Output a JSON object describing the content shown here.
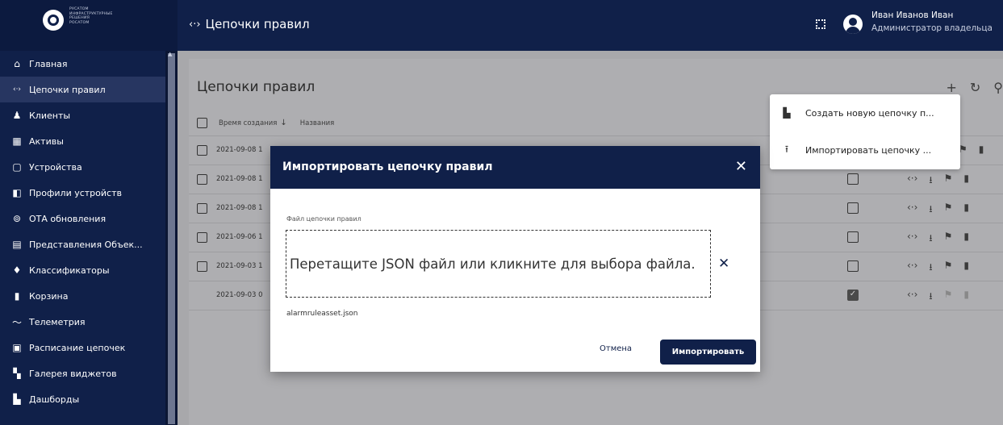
{
  "logo": {
    "lines": [
      "РУСАТОМ",
      "ИНФРАСТРУКТУРНЫЕ",
      "РЕШЕНИЯ",
      "РОСАТОМ"
    ]
  },
  "topbar": {
    "title": "Цепочки правил",
    "user_name": "Иван Иванов Иван",
    "user_role": "Администратор владельца"
  },
  "sidebar": {
    "items": [
      {
        "label": "Главная",
        "icon": "home-icon"
      },
      {
        "label": "Цепочки правил",
        "icon": "rule-chain-icon",
        "active": true
      },
      {
        "label": "Клиенты",
        "icon": "customers-icon"
      },
      {
        "label": "Активы",
        "icon": "assets-icon"
      },
      {
        "label": "Устройства",
        "icon": "devices-icon"
      },
      {
        "label": "Профили устройств",
        "icon": "device-profile-icon"
      },
      {
        "label": "ОТА обновления",
        "icon": "ota-icon"
      },
      {
        "label": "Представления Объек...",
        "icon": "entity-views-icon"
      },
      {
        "label": "Классификаторы",
        "icon": "classifiers-icon"
      },
      {
        "label": "Корзина",
        "icon": "trash-icon"
      },
      {
        "label": "Телеметрия",
        "icon": "telemetry-icon"
      },
      {
        "label": "Расписание цепочек",
        "icon": "schedule-icon"
      },
      {
        "label": "Галерея виджетов",
        "icon": "widgets-icon"
      },
      {
        "label": "Дашборды",
        "icon": "dashboards-icon"
      }
    ]
  },
  "card": {
    "title": "Цепочки правил",
    "col_time": "Время создания",
    "col_name": "Названия",
    "rows": [
      {
        "date": "2021-09-08 1",
        "root": false
      },
      {
        "date": "2021-09-08 1",
        "root": false
      },
      {
        "date": "2021-09-08 1",
        "root": false
      },
      {
        "date": "2021-09-06 1",
        "root": false
      },
      {
        "date": "2021-09-03 1",
        "root": false
      },
      {
        "date": "2021-09-03 0",
        "root": true
      }
    ]
  },
  "menu": {
    "create_label": "Создать новую цепочку п...",
    "import_label": "Импортировать цепочку ..."
  },
  "modal": {
    "title": "Импортировать цепочку правил",
    "field_label": "Файл цепочки правил",
    "dropzone_text": "Перетащите JSON файл или кликните для выбора файла.",
    "file_name": "alarmruleasset.json",
    "cancel_label": "Отмена",
    "import_label": "Импортировать"
  },
  "colors": {
    "primary": "#102049",
    "overlay": "#a8a8ab"
  }
}
